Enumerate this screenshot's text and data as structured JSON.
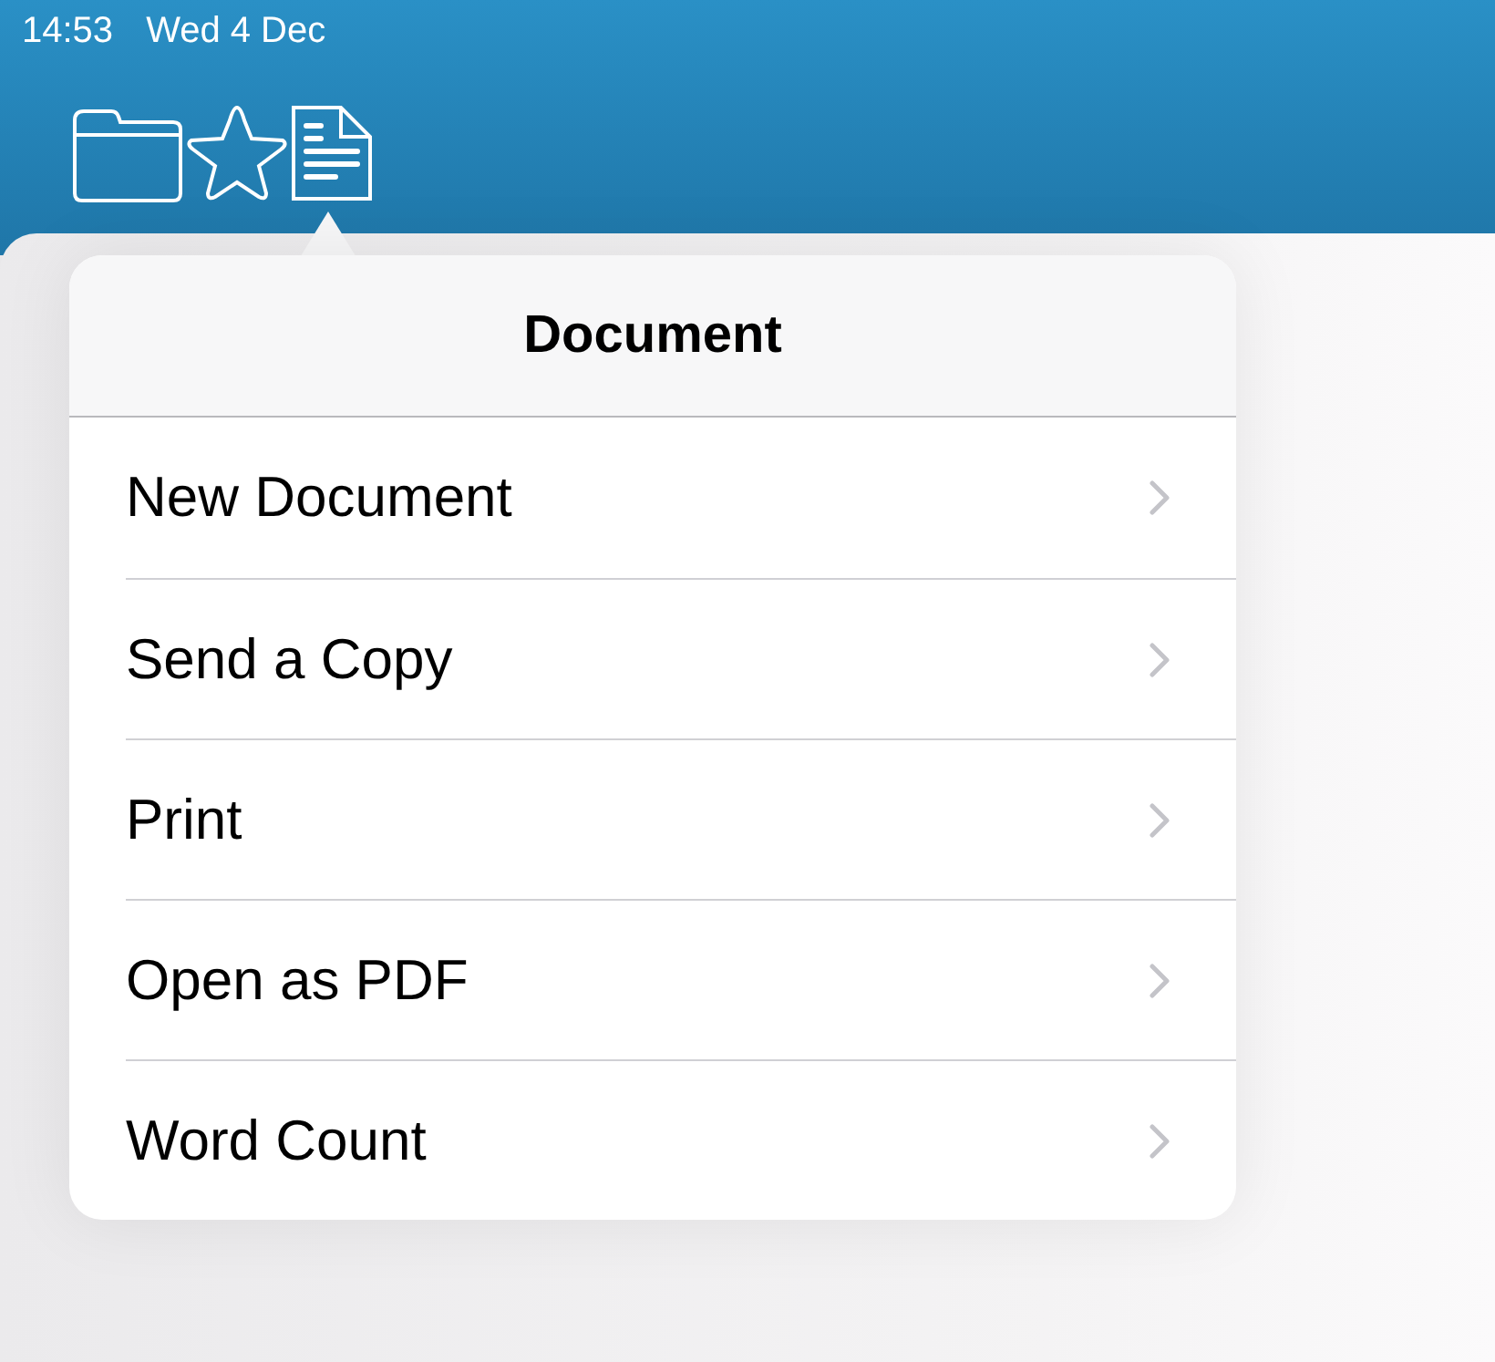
{
  "status_bar": {
    "time": "14:53",
    "date": "Wed 4 Dec"
  },
  "popover": {
    "title": "Document",
    "items": [
      {
        "label": "New Document"
      },
      {
        "label": "Send a Copy"
      },
      {
        "label": "Print"
      },
      {
        "label": "Open as PDF"
      },
      {
        "label": "Word Count"
      }
    ]
  }
}
